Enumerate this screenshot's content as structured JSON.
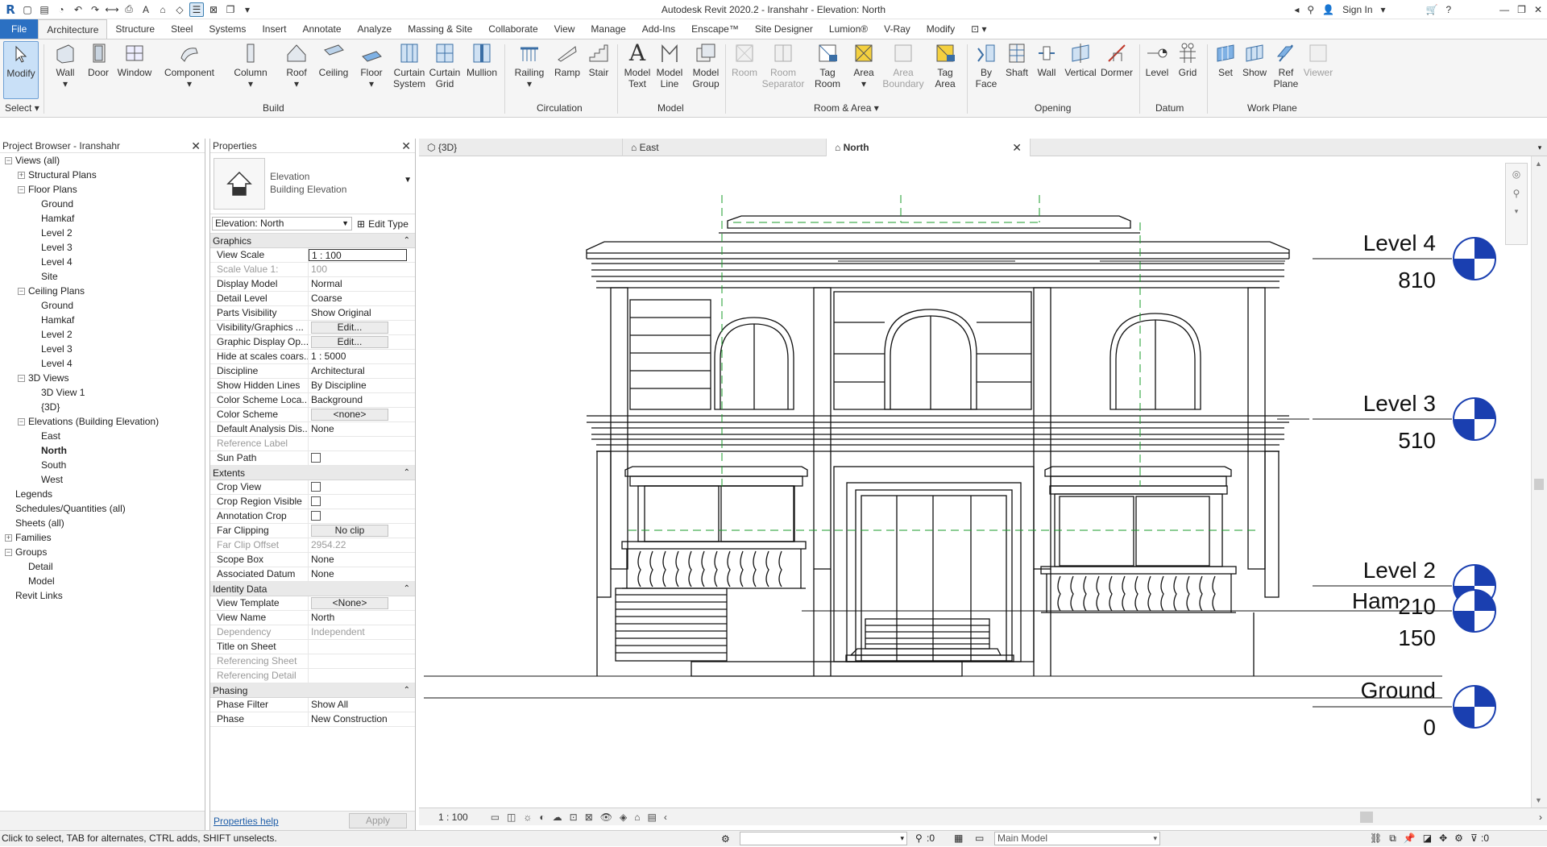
{
  "app": {
    "title": "Autodesk Revit 2020.2 - Iranshahr - Elevation: North",
    "sign_in": "Sign In",
    "logo": "R"
  },
  "tabs": [
    "File",
    "Architecture",
    "Structure",
    "Steel",
    "Systems",
    "Insert",
    "Annotate",
    "Analyze",
    "Massing & Site",
    "Collaborate",
    "View",
    "Manage",
    "Add-Ins",
    "Enscape™",
    "Site Designer",
    "Lumion®",
    "V-Ray",
    "Modify"
  ],
  "ribbon": {
    "modify": "Modify",
    "select": "Select",
    "build": [
      "Wall",
      "Door",
      "Window",
      "Component",
      "Column",
      "Roof",
      "Ceiling",
      "Floor",
      "Curtain System",
      "Curtain Grid",
      "Mullion"
    ],
    "build_label": "Build",
    "circulation": [
      "Railing",
      "Ramp",
      "Stair"
    ],
    "circulation_label": "Circulation",
    "model": [
      "Model Text",
      "Model Line",
      "Model Group"
    ],
    "model_label": "Model",
    "room": [
      "Room",
      "Room Separator",
      "Tag Room",
      "Area",
      "Area Boundary",
      "Tag Area"
    ],
    "room_label": "Room & Area",
    "opening": [
      "By Face",
      "Shaft",
      "Wall",
      "Vertical",
      "Dormer"
    ],
    "opening_label": "Opening",
    "datum": [
      "Level",
      "Grid"
    ],
    "datum_label": "Datum",
    "workplane": [
      "Set",
      "Show",
      "Ref Plane",
      "Viewer"
    ],
    "workplane_label": "Work Plane"
  },
  "project_browser": {
    "title": "Project Browser - Iranshahr",
    "items": [
      {
        "label": "Views (all)",
        "level": 0,
        "toggle": "-"
      },
      {
        "label": "Structural Plans",
        "level": 1,
        "toggle": "+"
      },
      {
        "label": "Floor Plans",
        "level": 1,
        "toggle": "-"
      },
      {
        "label": "Ground",
        "level": 2
      },
      {
        "label": "Hamkaf",
        "level": 2
      },
      {
        "label": "Level 2",
        "level": 2
      },
      {
        "label": "Level 3",
        "level": 2
      },
      {
        "label": "Level 4",
        "level": 2
      },
      {
        "label": "Site",
        "level": 2
      },
      {
        "label": "Ceiling Plans",
        "level": 1,
        "toggle": "-"
      },
      {
        "label": "Ground",
        "level": 2
      },
      {
        "label": "Hamkaf",
        "level": 2
      },
      {
        "label": "Level 2",
        "level": 2
      },
      {
        "label": "Level 3",
        "level": 2
      },
      {
        "label": "Level 4",
        "level": 2
      },
      {
        "label": "3D Views",
        "level": 1,
        "toggle": "-"
      },
      {
        "label": "3D View 1",
        "level": 2
      },
      {
        "label": "{3D}",
        "level": 2
      },
      {
        "label": "Elevations (Building Elevation)",
        "level": 1,
        "toggle": "-"
      },
      {
        "label": "East",
        "level": 2
      },
      {
        "label": "North",
        "level": 2,
        "bold": true
      },
      {
        "label": "South",
        "level": 2
      },
      {
        "label": "West",
        "level": 2
      },
      {
        "label": "Legends",
        "level": 0
      },
      {
        "label": "Schedules/Quantities (all)",
        "level": 0
      },
      {
        "label": "Sheets (all)",
        "level": 0
      },
      {
        "label": "Families",
        "level": 0,
        "toggle": "+"
      },
      {
        "label": "Groups",
        "level": 0,
        "toggle": "-"
      },
      {
        "label": "Detail",
        "level": 1
      },
      {
        "label": "Model",
        "level": 1
      },
      {
        "label": "Revit Links",
        "level": 0
      }
    ]
  },
  "properties": {
    "title": "Properties",
    "type_name": "Elevation",
    "type_sub": "Building Elevation",
    "selector": "Elevation: North",
    "edit_type": "Edit Type",
    "groups": [
      {
        "name": "Graphics",
        "rows": [
          [
            "View Scale",
            "1 : 100",
            "box"
          ],
          [
            "Scale Value    1:",
            "100",
            "gray"
          ],
          [
            "Display Model",
            "Normal"
          ],
          [
            "Detail Level",
            "Coarse"
          ],
          [
            "Parts Visibility",
            "Show Original"
          ],
          [
            "Visibility/Graphics ...",
            "Edit...",
            "btn"
          ],
          [
            "Graphic Display Op...",
            "Edit...",
            "btn"
          ],
          [
            "Hide at scales coars...",
            "1 : 5000"
          ],
          [
            "Discipline",
            "Architectural"
          ],
          [
            "Show Hidden Lines",
            "By Discipline"
          ],
          [
            "Color Scheme Loca...",
            "Background"
          ],
          [
            "Color Scheme",
            "<none>",
            "btn"
          ],
          [
            "Default Analysis Dis...",
            "None"
          ],
          [
            "Reference Label",
            "",
            "gray"
          ],
          [
            "Sun Path",
            "",
            "chk"
          ]
        ]
      },
      {
        "name": "Extents",
        "rows": [
          [
            "Crop View",
            "",
            "chk"
          ],
          [
            "Crop Region Visible",
            "",
            "chk"
          ],
          [
            "Annotation Crop",
            "",
            "chk"
          ],
          [
            "Far Clipping",
            "No clip",
            "btn"
          ],
          [
            "Far Clip Offset",
            "2954.22",
            "gray"
          ],
          [
            "Scope Box",
            "None"
          ],
          [
            "Associated Datum",
            "None"
          ]
        ]
      },
      {
        "name": "Identity Data",
        "rows": [
          [
            "View Template",
            "<None>",
            "btn"
          ],
          [
            "View Name",
            "North"
          ],
          [
            "Dependency",
            "Independent",
            "gray"
          ],
          [
            "Title on Sheet",
            ""
          ],
          [
            "Referencing Sheet",
            "",
            "gray"
          ],
          [
            "Referencing Detail",
            "",
            "gray"
          ]
        ]
      },
      {
        "name": "Phasing",
        "rows": [
          [
            "Phase Filter",
            "Show All"
          ],
          [
            "Phase",
            "New Construction"
          ]
        ]
      }
    ],
    "help": "Properties help",
    "apply": "Apply"
  },
  "view_tabs": [
    {
      "label": "{3D}"
    },
    {
      "label": "East"
    },
    {
      "label": "North",
      "active": true
    }
  ],
  "levels": [
    {
      "name": "Level 4",
      "elev": "810"
    },
    {
      "name": "Level 3",
      "elev": "510"
    },
    {
      "name": "Level 2",
      "elev": "210"
    },
    {
      "name": "Ham",
      "elev": "150"
    },
    {
      "name": "Ground",
      "elev": "0"
    }
  ],
  "view_control": {
    "scale": "1 : 100"
  },
  "status": {
    "hint": "Click to select, TAB for alternates, CTRL adds, SHIFT unselects.",
    "coord": ":0",
    "model": "Main Model",
    "filter": ":0"
  }
}
